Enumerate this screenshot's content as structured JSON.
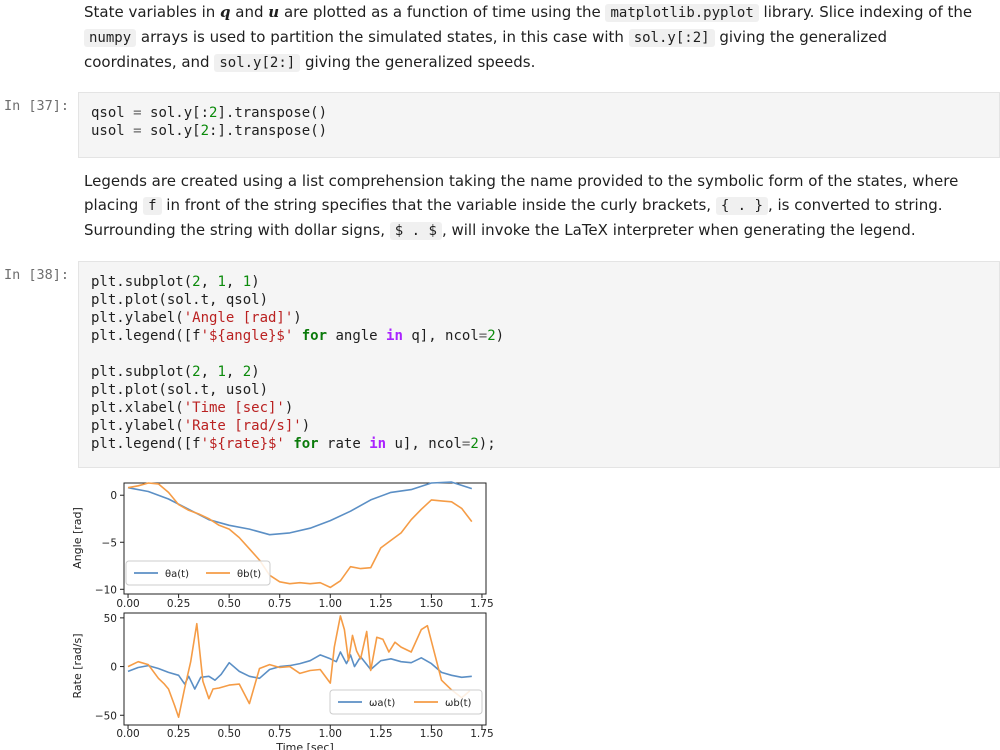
{
  "markdown1": {
    "t1": "State variables in ",
    "q": "q",
    "t2": " and ",
    "u": "u",
    "t3": " are plotted as a function of time using the ",
    "c1": "matplotlib.pyplot",
    "t4": " library. Slice indexing of the ",
    "c2": "numpy",
    "t5": " arrays is used to partition the simulated states, in this case with ",
    "c3": "sol.y[:2]",
    "t6": " giving the generalized coordinates, and ",
    "c4": "sol.y[2:]",
    "t7": " giving the generalized speeds."
  },
  "cell37": {
    "prompt": "In [37]:",
    "lines": [
      [
        [
          "p",
          "qsol "
        ],
        [
          "eq",
          "="
        ],
        [
          "p",
          " sol.y[:"
        ],
        [
          "num",
          "2"
        ],
        [
          "p",
          "].transpose()"
        ]
      ],
      [
        [
          "p",
          "usol "
        ],
        [
          "eq",
          "="
        ],
        [
          "p",
          " sol.y["
        ],
        [
          "num",
          "2"
        ],
        [
          "p",
          ":].transpose()"
        ]
      ]
    ]
  },
  "markdown2": {
    "t1": "Legends are created using a list comprehension taking the name provided to the symbolic form of the states, where placing ",
    "c1": "f",
    "t2": " in front of the string specifies that the variable inside the curly brackets, ",
    "c2": "{ . }",
    "t3": ", is converted to string. Surrounding the string with dollar signs, ",
    "c3": "$ . $",
    "t4": ", will invoke the LaTeX interpreter when generating the legend."
  },
  "cell38": {
    "prompt": "In [38]:",
    "lines": [
      [
        [
          "p",
          "plt.subplot("
        ],
        [
          "num",
          "2"
        ],
        [
          "p",
          ", "
        ],
        [
          "num",
          "1"
        ],
        [
          "p",
          ", "
        ],
        [
          "num",
          "1"
        ],
        [
          "p",
          ")"
        ]
      ],
      [
        [
          "p",
          "plt.plot(sol.t, qsol)"
        ]
      ],
      [
        [
          "p",
          "plt.ylabel("
        ],
        [
          "str",
          "'Angle [rad]'"
        ],
        [
          "p",
          ")"
        ]
      ],
      [
        [
          "p",
          "plt.legend([f"
        ],
        [
          "str",
          "'${angle}$'"
        ],
        [
          "p",
          " "
        ],
        [
          "kw",
          "for"
        ],
        [
          "p",
          " angle "
        ],
        [
          "op",
          "in"
        ],
        [
          "p",
          " q], ncol"
        ],
        [
          "eq",
          "="
        ],
        [
          "num",
          "2"
        ],
        [
          "p",
          ")"
        ]
      ],
      [],
      [
        [
          "p",
          "plt.subplot("
        ],
        [
          "num",
          "2"
        ],
        [
          "p",
          ", "
        ],
        [
          "num",
          "1"
        ],
        [
          "p",
          ", "
        ],
        [
          "num",
          "2"
        ],
        [
          "p",
          ")"
        ]
      ],
      [
        [
          "p",
          "plt.plot(sol.t, usol)"
        ]
      ],
      [
        [
          "p",
          "plt.xlabel("
        ],
        [
          "str",
          "'Time [sec]'"
        ],
        [
          "p",
          ")"
        ]
      ],
      [
        [
          "p",
          "plt.ylabel("
        ],
        [
          "str",
          "'Rate [rad/s]'"
        ],
        [
          "p",
          ")"
        ]
      ],
      [
        [
          "p",
          "plt.legend([f"
        ],
        [
          "str",
          "'${rate}$'"
        ],
        [
          "p",
          " "
        ],
        [
          "kw",
          "for"
        ],
        [
          "p",
          " rate "
        ],
        [
          "op",
          "in"
        ],
        [
          "p",
          " u], ncol"
        ],
        [
          "eq",
          "="
        ],
        [
          "num",
          "2"
        ],
        [
          "p",
          ");"
        ]
      ]
    ]
  },
  "colors": {
    "series_a": "#5b8fc5",
    "series_b": "#f59c46"
  },
  "chart_data": [
    {
      "type": "line",
      "ylabel": "Angle [rad]",
      "xlabel": "",
      "xlim": [
        -0.02,
        1.77
      ],
      "ylim": [
        -10.5,
        1.3
      ],
      "xticks": [
        "0.00",
        "0.25",
        "0.50",
        "0.75",
        "1.00",
        "1.25",
        "1.50",
        "1.75"
      ],
      "yticks": [
        0,
        -5,
        -10
      ],
      "legend_position": "lower-left",
      "series": [
        {
          "name": "θa(t)",
          "x": [
            0,
            0.1,
            0.2,
            0.3,
            0.4,
            0.5,
            0.6,
            0.7,
            0.8,
            0.9,
            1.0,
            1.1,
            1.2,
            1.3,
            1.4,
            1.5,
            1.6,
            1.7
          ],
          "y": [
            0.8,
            0.4,
            -0.4,
            -1.5,
            -2.6,
            -3.2,
            -3.6,
            -4.2,
            -4.0,
            -3.5,
            -2.7,
            -1.7,
            -0.5,
            0.3,
            0.6,
            1.3,
            1.4,
            0.7
          ]
        },
        {
          "name": "θb(t)",
          "x": [
            0,
            0.05,
            0.1,
            0.15,
            0.2,
            0.25,
            0.3,
            0.35,
            0.4,
            0.45,
            0.5,
            0.55,
            0.6,
            0.65,
            0.7,
            0.75,
            0.8,
            0.85,
            0.9,
            0.95,
            1.0,
            1.05,
            1.1,
            1.15,
            1.2,
            1.25,
            1.3,
            1.35,
            1.4,
            1.45,
            1.5,
            1.55,
            1.6,
            1.65,
            1.7
          ],
          "y": [
            0.8,
            1.0,
            1.3,
            1.2,
            0.3,
            -1.0,
            -1.6,
            -2.0,
            -2.5,
            -3.2,
            -3.6,
            -4.5,
            -5.7,
            -6.9,
            -8.5,
            -9.2,
            -9.4,
            -9.3,
            -9.4,
            -9.3,
            -9.8,
            -9.1,
            -7.6,
            -7.8,
            -7.7,
            -5.6,
            -4.8,
            -4.0,
            -2.6,
            -1.5,
            -0.5,
            -0.6,
            -0.7,
            -1.4,
            -2.8
          ]
        }
      ]
    },
    {
      "type": "line",
      "ylabel": "Rate [rad/s]",
      "xlabel": "Time [sec]",
      "xlim": [
        -0.02,
        1.77
      ],
      "ylim": [
        -60,
        55
      ],
      "xticks": [
        "0.00",
        "0.25",
        "0.50",
        "0.75",
        "1.00",
        "1.25",
        "1.50",
        "1.75"
      ],
      "yticks": [
        50,
        0,
        -50
      ],
      "legend_position": "lower-right",
      "series": [
        {
          "name": "ωa(t)",
          "x": [
            0,
            0.05,
            0.1,
            0.15,
            0.2,
            0.25,
            0.28,
            0.3,
            0.33,
            0.36,
            0.4,
            0.43,
            0.46,
            0.5,
            0.55,
            0.6,
            0.65,
            0.7,
            0.75,
            0.8,
            0.85,
            0.9,
            0.95,
            1.0,
            1.03,
            1.05,
            1.08,
            1.1,
            1.12,
            1.15,
            1.2,
            1.25,
            1.3,
            1.35,
            1.4,
            1.45,
            1.5,
            1.55,
            1.6,
            1.65,
            1.7
          ],
          "y": [
            -5,
            -1,
            1,
            -2,
            -6,
            -9,
            -18,
            -10,
            -23,
            -11,
            -10,
            -14,
            -8,
            4,
            -5,
            -10,
            -12,
            -3,
            0,
            1,
            3,
            6,
            12,
            8,
            5,
            15,
            3,
            12,
            0,
            10,
            -3,
            6,
            8,
            5,
            4,
            9,
            3,
            -6,
            -9,
            -11,
            -10
          ]
        },
        {
          "name": "ωb(t)",
          "x": [
            0,
            0.05,
            0.1,
            0.15,
            0.18,
            0.2,
            0.23,
            0.25,
            0.28,
            0.31,
            0.34,
            0.37,
            0.4,
            0.42,
            0.45,
            0.5,
            0.55,
            0.6,
            0.65,
            0.7,
            0.75,
            0.8,
            0.85,
            0.9,
            0.95,
            1.0,
            1.02,
            1.05,
            1.07,
            1.09,
            1.11,
            1.13,
            1.15,
            1.18,
            1.2,
            1.23,
            1.26,
            1.29,
            1.32,
            1.35,
            1.4,
            1.45,
            1.48,
            1.5,
            1.55,
            1.6,
            1.65,
            1.69
          ],
          "y": [
            0,
            5,
            2,
            -12,
            -18,
            -23,
            -40,
            -52,
            -22,
            5,
            44,
            -15,
            -33,
            -23,
            -22,
            -19,
            -18,
            -38,
            -2,
            2,
            -1,
            0,
            -7,
            -4,
            -3,
            -17,
            20,
            52,
            38,
            6,
            32,
            16,
            8,
            36,
            -4,
            30,
            28,
            15,
            25,
            20,
            15,
            38,
            42,
            26,
            -14,
            -24,
            -32,
            -25
          ]
        }
      ]
    }
  ]
}
